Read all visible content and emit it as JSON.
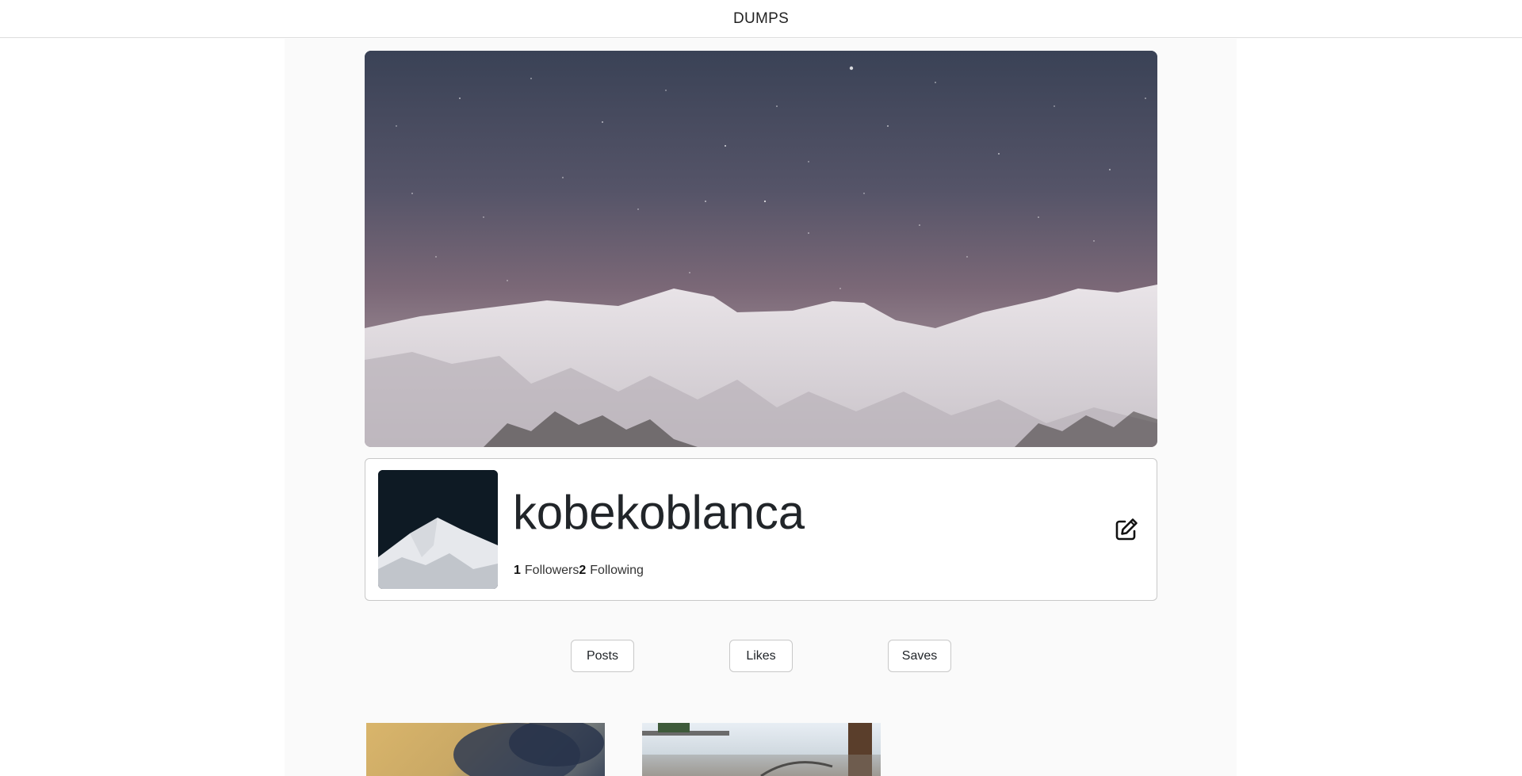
{
  "header": {
    "brand": "DUMPS"
  },
  "profile": {
    "username": "kobekoblanca",
    "followers_count": "1",
    "followers_label": "Followers",
    "following_count": "2",
    "following_label": "Following"
  },
  "tabs": [
    {
      "label": "Posts"
    },
    {
      "label": "Likes"
    },
    {
      "label": "Saves"
    }
  ],
  "icons": {
    "edit": "edit-icon"
  }
}
